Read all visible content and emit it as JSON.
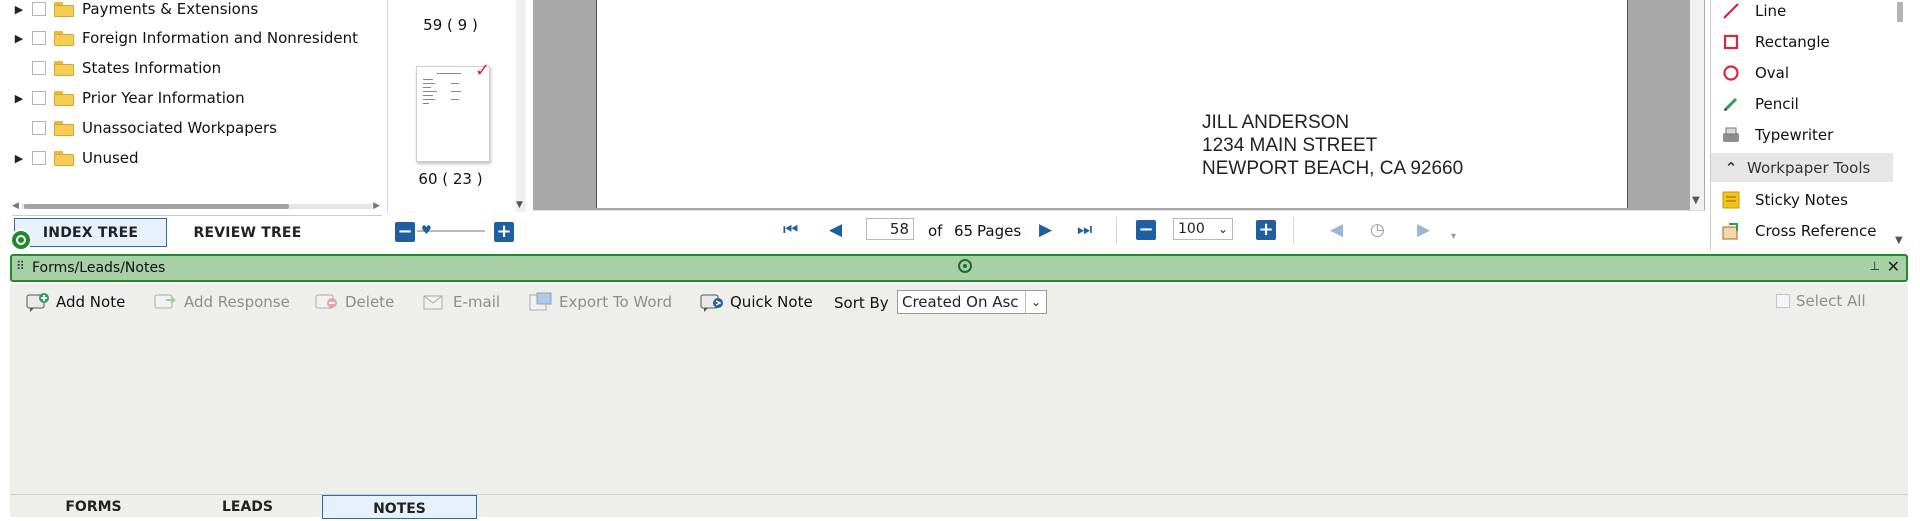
{
  "tree": {
    "items": [
      {
        "label": "Payments & Extensions",
        "expandable": true
      },
      {
        "label": "Foreign Information and Nonresident",
        "expandable": true
      },
      {
        "label": "States Information",
        "expandable": false
      },
      {
        "label": "Prior Year Information",
        "expandable": true
      },
      {
        "label": "Unassociated Workpapers",
        "expandable": false
      },
      {
        "label": "Unused",
        "expandable": true
      }
    ],
    "tabs": {
      "index": "INDEX TREE",
      "review": "REVIEW TREE"
    }
  },
  "thumbnails": {
    "label_top": "59 ( 9 )",
    "label_bottom": "60 ( 23 )",
    "check": "✓"
  },
  "document": {
    "address": [
      "JILL ANDERSON",
      "1234 MAIN STREET",
      "NEWPORT BEACH, CA 92660"
    ]
  },
  "pager": {
    "current_page": "58",
    "of_label": "of",
    "total_pages": "65",
    "pages_label": "Pages",
    "zoom": "100"
  },
  "tools": {
    "items": [
      {
        "label": "Line",
        "icon": "line-icon"
      },
      {
        "label": "Rectangle",
        "icon": "rectangle-icon"
      },
      {
        "label": "Oval",
        "icon": "oval-icon"
      },
      {
        "label": "Pencil",
        "icon": "pencil-icon"
      },
      {
        "label": "Typewriter",
        "icon": "typewriter-icon"
      }
    ],
    "section": "Workpaper Tools",
    "section_items": [
      {
        "label": "Sticky Notes",
        "icon": "sticky-notes-icon"
      },
      {
        "label": "Cross Reference",
        "icon": "cross-reference-icon"
      }
    ]
  },
  "panel": {
    "title": "Forms/Leads/Notes",
    "accent": "#1f8b2b"
  },
  "notes_toolbar": {
    "add_note": "Add Note",
    "add_response": "Add Response",
    "delete": "Delete",
    "email": "E-mail",
    "export_to_word": "Export To Word",
    "quick_note": "Quick Note",
    "sort_by_label": "Sort By",
    "sort_by_value": "Created On Asc",
    "select_all": "Select All"
  },
  "bottom_tabs": {
    "forms": "FORMS",
    "leads": "LEADS",
    "notes": "NOTES"
  },
  "glyphs": {
    "collapse": "−",
    "expand": "+",
    "first": "⏮",
    "prev": "◀",
    "next": "▶",
    "last": "⏭",
    "caret_up": "^",
    "chevron_down": "⌄",
    "close": "✕",
    "pin": "⊥",
    "grip": "⠿"
  }
}
